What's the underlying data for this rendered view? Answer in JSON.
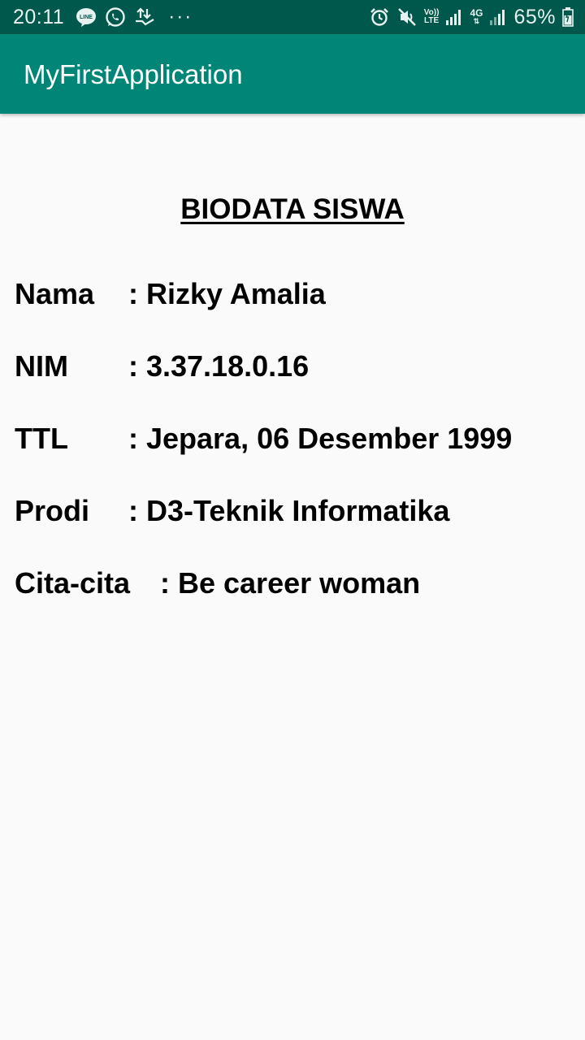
{
  "status_bar": {
    "time": "20:11",
    "battery_text": "65%",
    "icons_left": [
      "line-icon",
      "whatsapp-icon",
      "data-transfer-icon",
      "more-dots-icon"
    ],
    "icons_right": [
      "alarm-icon",
      "mute-icon",
      "volte-icon",
      "signal-icon",
      "4g-icon",
      "signal-icon",
      "battery-icon"
    ],
    "volte_top": "Vo))",
    "volte_bottom": "LTE",
    "network_label": "4G",
    "more_dots": "···"
  },
  "app_bar": {
    "title": "MyFirstApplication",
    "color": "#008577",
    "status_color": "#00574b"
  },
  "biodata": {
    "heading": "BIODATA SISWA",
    "rows": [
      {
        "label": "Nama",
        "value": ": Rizky Amalia"
      },
      {
        "label": "NIM",
        "value": ": 3.37.18.0.16"
      },
      {
        "label": "TTL",
        "value": ": Jepara, 06 Desember 1999"
      },
      {
        "label": "Prodi",
        "value": ": D3-Teknik Informatika"
      },
      {
        "label": "Cita-cita",
        "value": ": Be career woman"
      }
    ]
  }
}
